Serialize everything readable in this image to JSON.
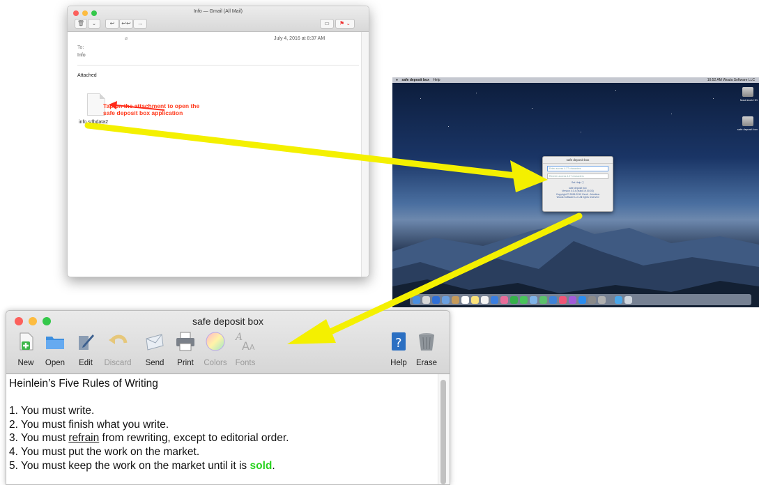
{
  "mail": {
    "title": "Info — Gmail (All Mail)",
    "date": "July 4, 2016 at 8:37 AM",
    "to_label": "To:",
    "to_value": "Info",
    "body_text": "Attached",
    "attachment_name": "info.sdbdata2"
  },
  "annotation": {
    "line1": "Tap on the attachment to open the",
    "line2": "safe deposit box application"
  },
  "desktop": {
    "menubar_app": "safe deposit box",
    "menubar_help": "Help",
    "menubar_right": "10:52 AM   Woula Software LLC",
    "drive1_label": "Macintosh HD",
    "drive2_label": "safe deposit box",
    "mini_title": "safe deposit box",
    "mini_field1": "Enter access 4-27 characters",
    "mini_field2": "Reenter access 4-27 characters",
    "mini_link": "Set Help",
    "mini_info": [
      "safe deposit box",
      "Version 4.0.4 (build 19.00.03)",
      "Copyright © 2008-2019 Gerrit - Moebius",
      "Woola Software LLC  All rights reserved"
    ]
  },
  "app": {
    "title": "safe deposit box",
    "toolbar": {
      "new": "New",
      "open": "Open",
      "edit": "Edit",
      "discard": "Discard",
      "send": "Send",
      "print": "Print",
      "colors": "Colors",
      "fonts": "Fonts",
      "help": "Help",
      "erase": "Erase"
    },
    "document": {
      "heading": "Heinlein’s Five Rules of Writing",
      "rule1": "1. You must write.",
      "rule2": "2. You must finish what you write.",
      "rule3_pre": "3. You must ",
      "rule3_word": "refrain",
      "rule3_post": " from rewriting, except to editorial order.",
      "rule4": "4. You must put the work on the market.",
      "rule5_pre": "5. You must keep the work on the market until it is ",
      "rule5_word": "sold",
      "rule5_post": "."
    }
  },
  "colors": {
    "arrow_yellow": "#f4f000",
    "annotation_red": "#ff3a1c",
    "sold_green": "#28d21e"
  }
}
